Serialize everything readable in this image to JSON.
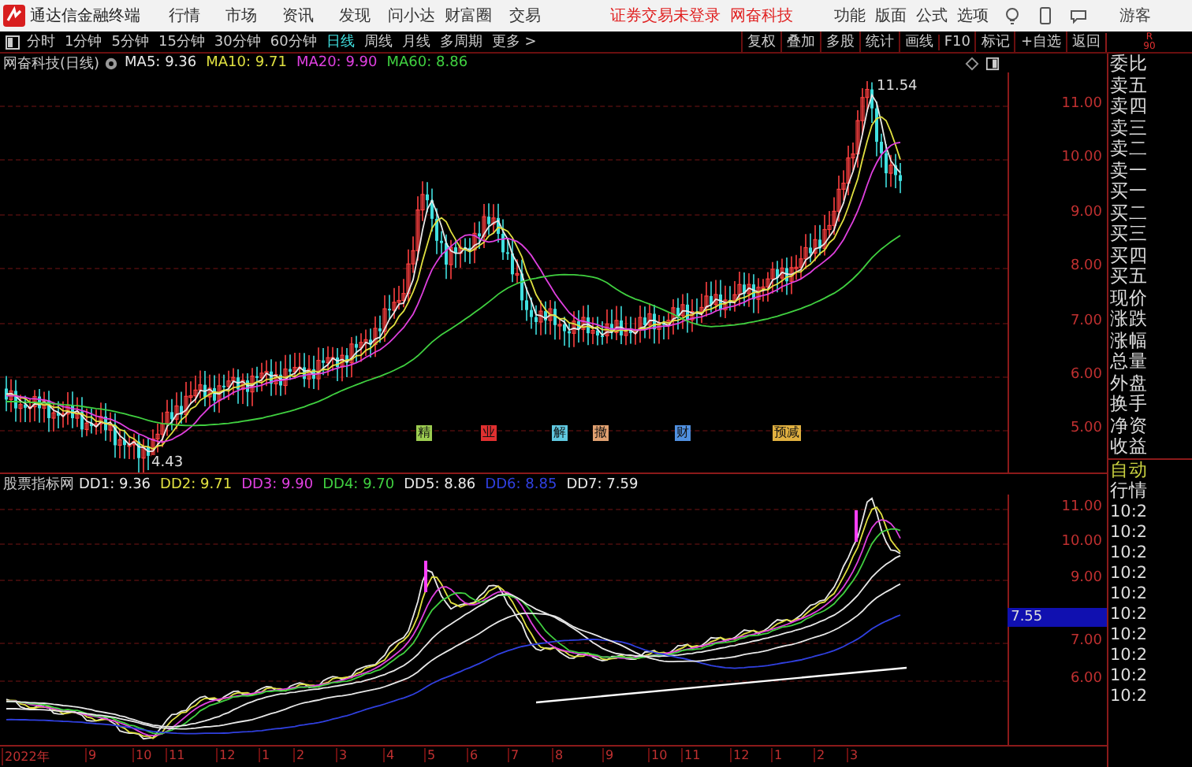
{
  "app": {
    "title": "通达信金融终端"
  },
  "menu": [
    "行情",
    "市场",
    "资讯",
    "发现",
    "问小达",
    "财富圈",
    "交易"
  ],
  "login_status": "证券交易未登录",
  "broker": "网奋科技",
  "top_links": [
    "功能",
    "版面",
    "公式",
    "选项"
  ],
  "user": "游客",
  "periods": [
    {
      "label": "分时",
      "selected": false
    },
    {
      "label": "1分钟",
      "selected": false
    },
    {
      "label": "5分钟",
      "selected": false
    },
    {
      "label": "15分钟",
      "selected": false
    },
    {
      "label": "30分钟",
      "selected": false
    },
    {
      "label": "60分钟",
      "selected": false
    },
    {
      "label": "日线",
      "selected": true
    },
    {
      "label": "周线",
      "selected": false
    },
    {
      "label": "月线",
      "selected": false
    },
    {
      "label": "多周期",
      "selected": false
    },
    {
      "label": "更多 >",
      "selected": false
    }
  ],
  "tools": [
    "复权",
    "叠加",
    "多股",
    "统计",
    "画线",
    "F10",
    "标记",
    "+自选",
    "返回"
  ],
  "r_badge": {
    "letter": "R",
    "value": "90"
  },
  "main_chart": {
    "title": "网奋科技(日线)",
    "ma": [
      {
        "label": "MA5: 9.36",
        "color": "#e8e8e8"
      },
      {
        "label": "MA10: 9.71",
        "color": "#e0e040"
      },
      {
        "label": "MA20: 9.90",
        "color": "#e040e0"
      },
      {
        "label": "MA60: 8.86",
        "color": "#40d040"
      }
    ],
    "high_label": "11.54",
    "low_label": "4.43",
    "y_labels": [
      "11.00",
      "10.00",
      "9.00",
      "8.00",
      "7.00",
      "6.00",
      "5.00"
    ],
    "events": [
      {
        "label": "精",
        "color": "#9ccc50"
      },
      {
        "label": "业",
        "color": "#e03030"
      },
      {
        "label": "解",
        "color": "#60c8e0"
      },
      {
        "label": "撤",
        "color": "#e0a070"
      },
      {
        "label": "财",
        "color": "#5090e0"
      },
      {
        "label": "预减",
        "color": "#e0b040"
      }
    ]
  },
  "indicator": {
    "title": "股票指标网",
    "lines": [
      {
        "label": "DD1: 9.36",
        "color": "#e8e8e8"
      },
      {
        "label": "DD2: 9.71",
        "color": "#e0e040"
      },
      {
        "label": "DD3: 9.90",
        "color": "#e040e0"
      },
      {
        "label": "DD4: 9.70",
        "color": "#40d040"
      },
      {
        "label": "DD5: 8.86",
        "color": "#e8e8e8"
      },
      {
        "label": "DD6: 8.85",
        "color": "#3040e0"
      },
      {
        "label": "DD7: 7.59",
        "color": "#e8e8e8"
      }
    ],
    "y_labels": [
      "11.00",
      "10.00",
      "9.00",
      "7.00",
      "6.00"
    ],
    "current": "7.55"
  },
  "date_axis": [
    "2022年",
    "9",
    "10",
    "11",
    "12",
    "1",
    "2",
    "3",
    "4",
    "5",
    "6",
    "7",
    "8",
    "9",
    "10",
    "11",
    "12",
    "1",
    "2",
    "3"
  ],
  "quote_fields": [
    "委比",
    "卖五",
    "卖四",
    "卖三",
    "卖二",
    "卖一",
    "买一",
    "买二",
    "买三",
    "买四",
    "买五",
    "现价",
    "涨跌",
    "涨幅",
    "总量",
    "外盘",
    "换手",
    "净资",
    "收益"
  ],
  "trade_panel": {
    "mode": "自动",
    "title": "行情",
    "times": [
      "10:2",
      "10:2",
      "10:2",
      "10:2",
      "10:2",
      "10:2",
      "10:2",
      "10:2",
      "10:2",
      "10:2"
    ]
  }
}
